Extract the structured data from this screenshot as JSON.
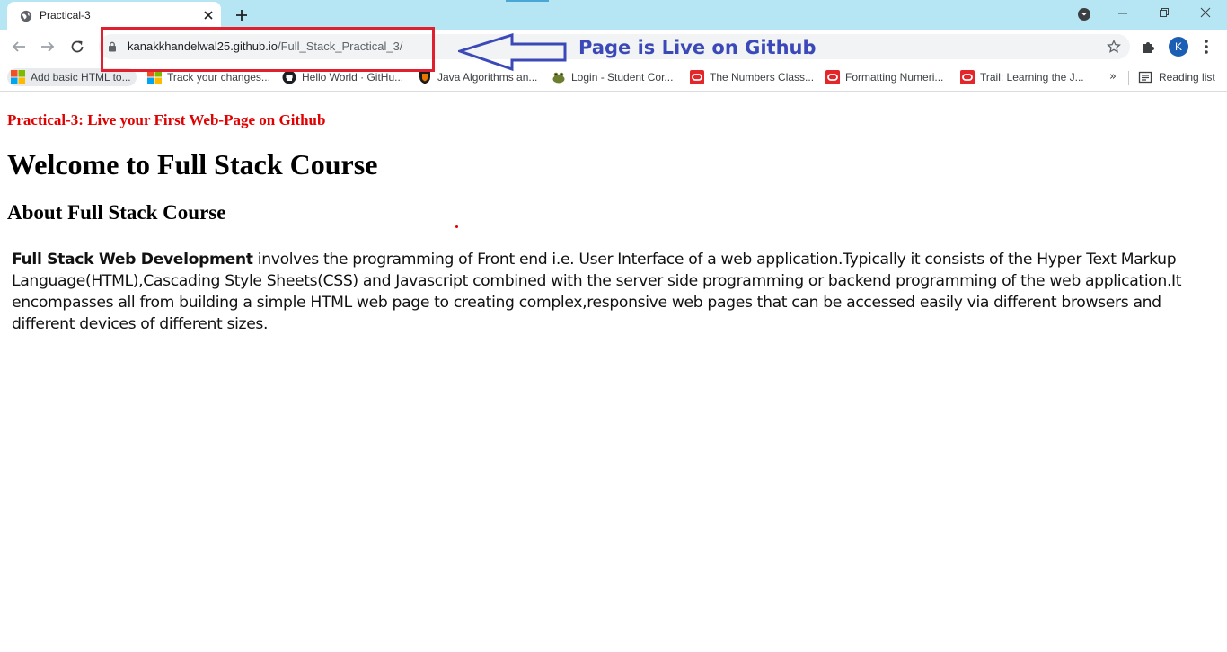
{
  "browser": {
    "tab": {
      "title": "Practical-3"
    },
    "address": {
      "host": "kanakkhandelwal25.github.io",
      "path": "/Full_Stack_Practical_3/"
    },
    "profile_initial": "K",
    "bookmarks": [
      {
        "label": "Add basic HTML to...",
        "icon": "microsoft-icon"
      },
      {
        "label": "Track your changes...",
        "icon": "microsoft-icon"
      },
      {
        "label": "Hello World · GitHu...",
        "icon": "github-icon"
      },
      {
        "label": "Java Algorithms an...",
        "icon": "princeton-icon"
      },
      {
        "label": "Login - Student Cor...",
        "icon": "frog-icon"
      },
      {
        "label": "The Numbers Class...",
        "icon": "oracle-icon"
      },
      {
        "label": "Formatting Numeri...",
        "icon": "oracle-icon"
      },
      {
        "label": "Trail: Learning the J...",
        "icon": "oracle-icon"
      }
    ],
    "overflow_label": "»",
    "reading_list_label": "Reading list"
  },
  "annotation": {
    "callout_text": "Page is Live on Github",
    "colors": {
      "box": "#e0202e",
      "arrow": "#3b49b8",
      "text": "#3b49b8"
    }
  },
  "page": {
    "practical_heading": "Practical-3: Live your First Web-Page on Github",
    "main_heading": "Welcome to Full Stack Course",
    "sub_heading": "About Full Stack Course",
    "paragraph": {
      "bold": "Full Stack Web Development",
      "text": " involves the programming of Front end i.e. User Interface of a web application.Typically it consists of the Hyper Text Markup Language(HTML),Cascading Style Sheets(CSS) and Javascript combined with the server side programming or backend programming of the web application.It encompasses all from building a simple HTML web page to creating complex,responsive web pages that can be accessed easily via different browsers and different devices of different sizes."
    }
  },
  "colors": {
    "tabstrip": "#b6e5f4",
    "heading_red": "#e00000"
  }
}
